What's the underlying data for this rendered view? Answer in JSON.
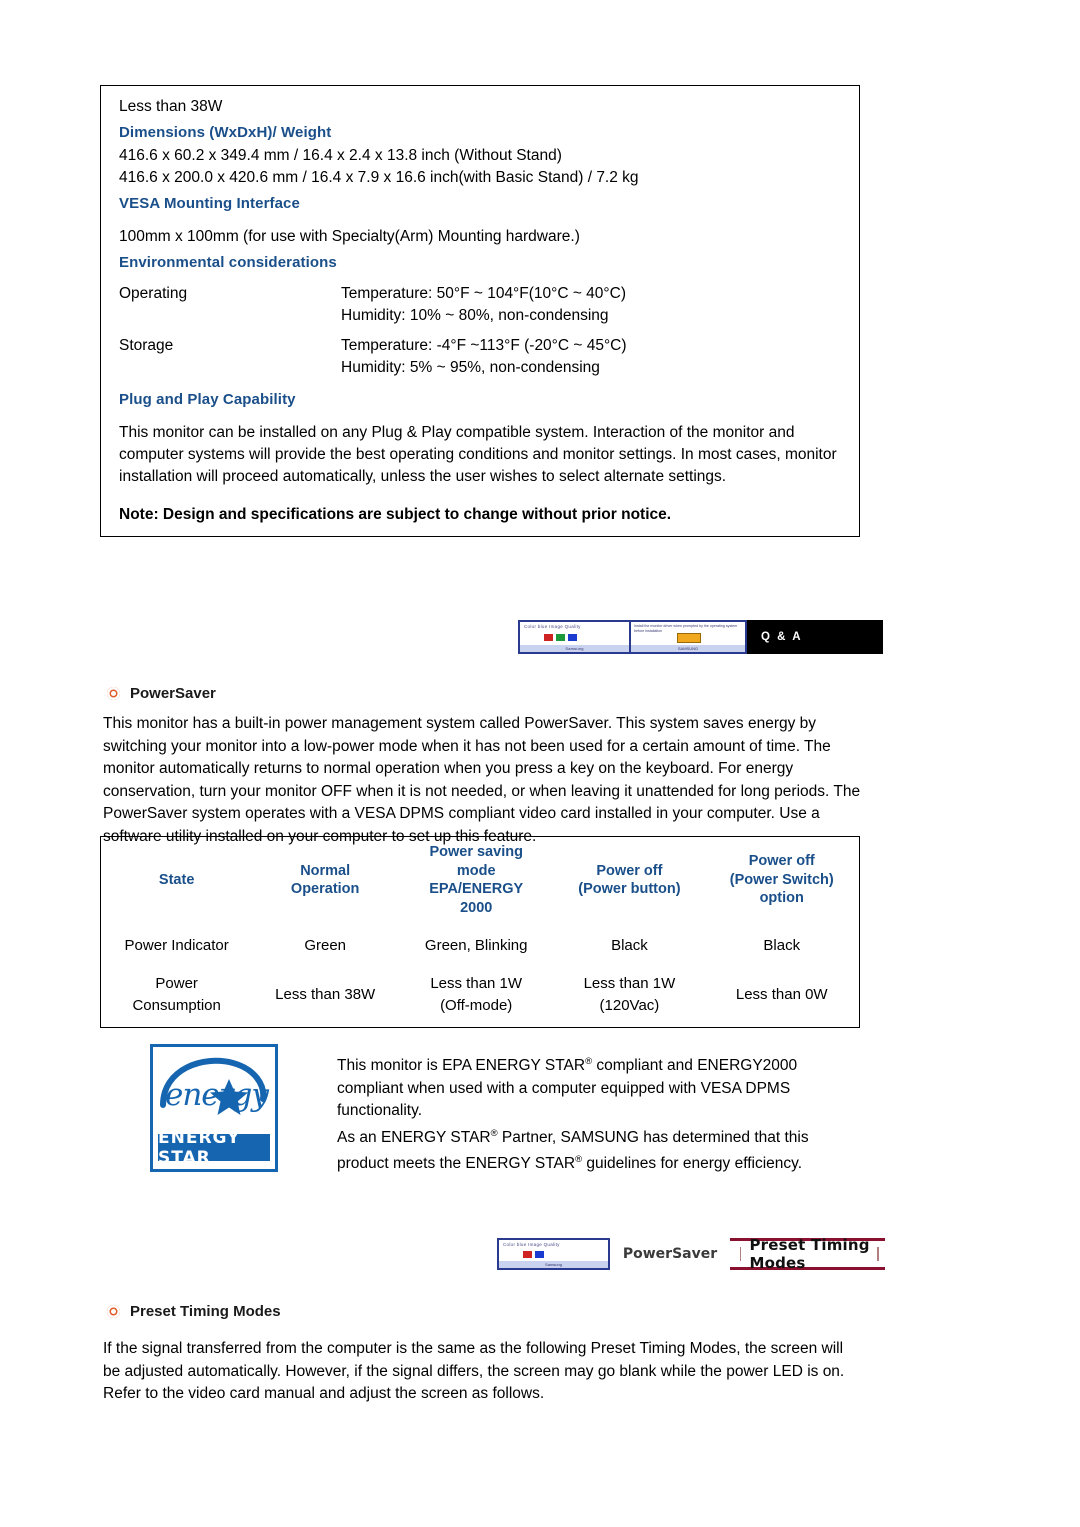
{
  "spec": {
    "power_value": "Less than 38W",
    "dimensions_heading": "Dimensions (WxDxH)/ Weight",
    "dimensions_line1": "416.6 x 60.2 x 349.4 mm / 16.4 x 2.4 x 13.8 inch (Without Stand)",
    "dimensions_line2": "416.6 x 200.0 x 420.6 mm / 16.4 x 7.9 x 16.6 inch(with Basic Stand) / 7.2 kg",
    "vesa_heading": "VESA Mounting Interface",
    "vesa_text": "100mm x 100mm (for use with Specialty(Arm) Mounting hardware.)",
    "env_heading": "Environmental considerations",
    "env_rows": [
      {
        "label": "Operating",
        "line1": "Temperature: 50°F ~ 104°F(10°C ~ 40°C)",
        "line2": "Humidity: 10% ~ 80%, non-condensing"
      },
      {
        "label": "Storage",
        "line1": "Temperature: -4°F ~113°F (-20°C ~ 45°C)",
        "line2": "Humidity: 5% ~ 95%, non-condensing"
      }
    ],
    "pnp_heading": "Plug and Play Capability",
    "pnp_text": "This monitor can be installed on any Plug & Play compatible system. Interaction of the monitor and computer systems will provide the best operating conditions and monitor settings. In most cases, monitor installation will proceed automatically, unless the user wishes to select alternate settings.",
    "note": "Note: Design and specifications are subject to change without prior notice."
  },
  "navstrip1": {
    "thumb_caption": "Color blue Image Quality",
    "thumb_bar_label": "Samsung",
    "panel_text": "Install the monitor driver when prompted by the operating system before installation",
    "panel_bar_label": "SAMSUNG",
    "black_label": "Q & A"
  },
  "navstrip2": {
    "thumb_caption": "Color blue Image Quality",
    "thumb_bar_label": "Samsung",
    "label_powersaver": "PowerSaver",
    "label_preset": "Preset Timing Modes"
  },
  "powersaver": {
    "heading": "PowerSaver",
    "paragraph": "This monitor has a built-in power management system called PowerSaver. This system saves energy by switching your monitor into a low-power mode when it has not been used for a certain amount of time. The monitor automatically returns to normal operation when you press a key on the keyboard. For energy conservation, turn your monitor OFF when it is not needed, or when leaving it unattended for long periods. The PowerSaver system operates with a VESA DPMS compliant video card installed in your computer. Use a software utility installed on your computer to set up this feature.",
    "table": {
      "headers": [
        "State",
        "Normal Operation",
        "Power saving mode EPA/ENERGY 2000",
        "Power off (Power button)",
        "Power off (Power Switch) option"
      ],
      "headers_parts": {
        "state": "State",
        "normal_l1": "Normal",
        "normal_l2": "Operation",
        "saving_l1": "Power saving",
        "saving_l2": "mode",
        "saving_l3": "EPA/ENERGY",
        "saving_l4": "2000",
        "off_l1": "Power off",
        "off_l2": "(Power button)",
        "switch_l1": "Power off",
        "switch_l2": "(Power Switch)",
        "switch_l3": "option"
      },
      "rows": [
        {
          "label": "Power Indicator",
          "normal": "Green",
          "saving": "Green, Blinking",
          "off": "Black",
          "switch": "Black"
        },
        {
          "label_l1": "Power",
          "label_l2": "Consumption",
          "normal": "Less than 38W",
          "saving_l1": "Less than 1W",
          "saving_l2": "(Off-mode)",
          "off_l1": "Less than 1W",
          "off_l2": "(120Vac)",
          "switch": "Less than 0W"
        }
      ]
    }
  },
  "energystar": {
    "logo_word": "energy",
    "logo_bar": "ENERGY STAR",
    "text_line1_a": "This monitor is EPA ENERGY STAR",
    "text_line1_reg": "®",
    "text_line1_b": " compliant and ENERGY2000",
    "text_line2": "compliant when used with a computer equipped with VESA DPMS",
    "text_line3": "functionality.",
    "text_line4_a": "As an ENERGY STAR",
    "text_line4_b": " Partner, SAMSUNG has determined that this",
    "text_line5_a": "product meets the ENERGY STAR",
    "text_line5_b": " guidelines for energy efficiency."
  },
  "preset": {
    "heading": "Preset Timing Modes",
    "paragraph": "If the signal transferred from the computer is the same as the following Preset Timing Modes, the screen will be adjusted automatically. However, if the signal differs, the screen may go blank while the power LED is on. Refer to the video card manual and adjust the screen as follows."
  },
  "colors": {
    "heading_blue": "#1a4f8a",
    "bullet_orange": "#e05a2b",
    "energystar_blue": "#1565b0",
    "navy": "#2a3b8f",
    "maroon": "#8a1030"
  }
}
